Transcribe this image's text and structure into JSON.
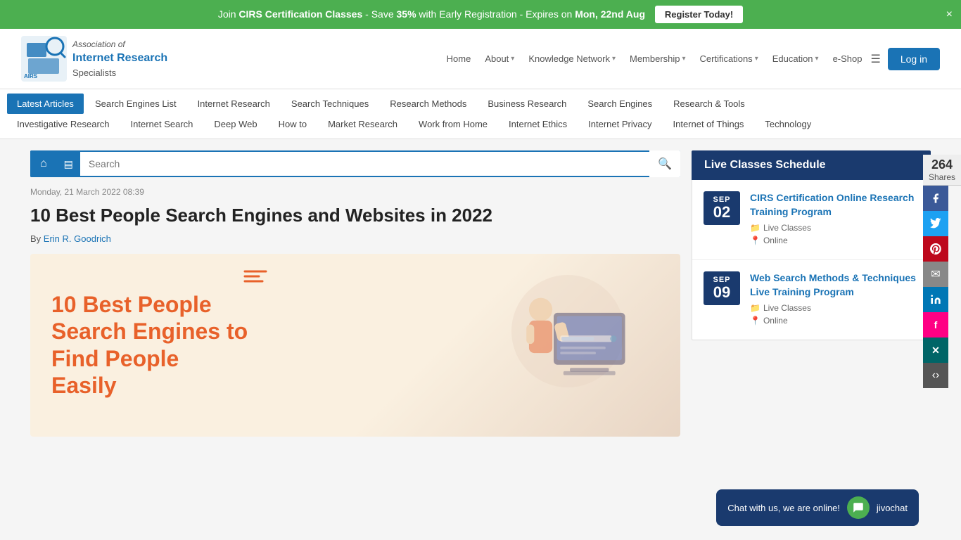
{
  "banner": {
    "text_pre": "Join ",
    "org": "CIRS Certification Classes",
    "text_mid": " -  Save ",
    "discount": "35%",
    "text_post": " with Early Registration - Expires on ",
    "date": "Mon, 22nd Aug",
    "register_label": "Register Today!",
    "close_label": "×"
  },
  "header": {
    "logo": {
      "line1": "Association of",
      "line2": "Internet Research",
      "line3": "Specialists"
    },
    "nav": [
      {
        "label": "Home",
        "has_dropdown": false
      },
      {
        "label": "About",
        "has_dropdown": true
      },
      {
        "label": "Knowledge Network",
        "has_dropdown": true
      },
      {
        "label": "Membership",
        "has_dropdown": true
      },
      {
        "label": "Certifications",
        "has_dropdown": true
      },
      {
        "label": "Education",
        "has_dropdown": true
      },
      {
        "label": "e-Shop",
        "has_dropdown": false
      }
    ],
    "login_label": "Log in"
  },
  "category_tabs_row1": [
    {
      "label": "Latest Articles",
      "active": true
    },
    {
      "label": "Search Engines List",
      "active": false
    },
    {
      "label": "Internet Research",
      "active": false
    },
    {
      "label": "Search Techniques",
      "active": false
    },
    {
      "label": "Research Methods",
      "active": false
    },
    {
      "label": "Business Research",
      "active": false
    },
    {
      "label": "Search Engines",
      "active": false
    },
    {
      "label": "Research & Tools",
      "active": false
    }
  ],
  "category_tabs_row2": [
    {
      "label": "Investigative Research",
      "active": false
    },
    {
      "label": "Internet Search",
      "active": false
    },
    {
      "label": "Deep Web",
      "active": false
    },
    {
      "label": "How to",
      "active": false
    },
    {
      "label": "Market Research",
      "active": false
    },
    {
      "label": "Work from Home",
      "active": false
    },
    {
      "label": "Internet Ethics",
      "active": false
    },
    {
      "label": "Internet Privacy",
      "active": false
    },
    {
      "label": "Internet of Things",
      "active": false
    },
    {
      "label": "Technology",
      "active": false
    }
  ],
  "share": {
    "count": "264",
    "count_label": "Shares",
    "buttons": [
      {
        "name": "facebook",
        "icon": "f",
        "class": "share-fb"
      },
      {
        "name": "twitter",
        "icon": "t",
        "class": "share-tw"
      },
      {
        "name": "pinterest",
        "icon": "p",
        "class": "share-pt"
      },
      {
        "name": "email",
        "icon": "✉",
        "class": "share-em"
      },
      {
        "name": "linkedin",
        "icon": "in",
        "class": "share-li"
      },
      {
        "name": "flipboard",
        "icon": "f",
        "class": "share-fl"
      },
      {
        "name": "xing",
        "icon": "x",
        "class": "share-xing"
      },
      {
        "name": "sharethis",
        "icon": "+",
        "class": "share-more"
      }
    ]
  },
  "search_bar": {
    "placeholder": "Search",
    "home_icon": "⌂",
    "articles_icon": "▤",
    "search_icon": "🔍"
  },
  "article": {
    "date": "Monday, 21 March 2022 08:39",
    "title": "10 Best People Search Engines and Websites in 2022",
    "author_prefix": "By",
    "author_name": "Erin R. Goodrich",
    "image_text": "10 Best People Search Engines to Find People Easily"
  },
  "sidebar": {
    "live_classes_title": "Live Classes Schedule",
    "classes": [
      {
        "month": "SEP",
        "day": "02",
        "title": "CIRS Certification Online Research Training Program",
        "category": "Live Classes",
        "location": "Online"
      },
      {
        "month": "SEP",
        "day": "09",
        "title": "Web Search Methods & Techniques Live Training Program",
        "category": "Live Classes",
        "location": "Online"
      }
    ]
  },
  "chat": {
    "text": "Chat with us, we are online!",
    "service": "jivochat"
  }
}
